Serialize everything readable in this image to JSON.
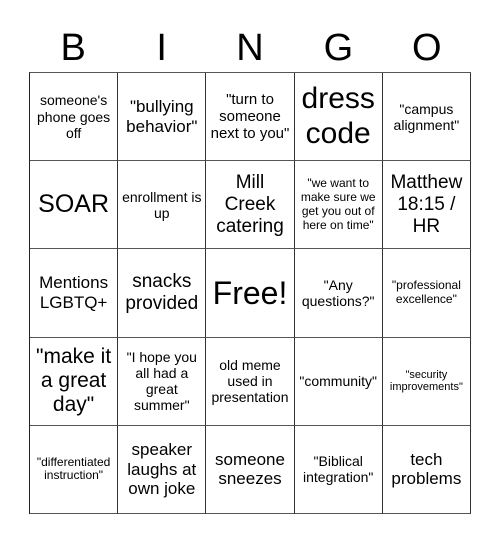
{
  "card": {
    "header": [
      "B",
      "I",
      "N",
      "G",
      "O"
    ],
    "rows": [
      [
        {
          "text": "someone's phone goes off",
          "size": "fs-m"
        },
        {
          "text": "\"bullying behavior\"",
          "size": "fs-l"
        },
        {
          "text": "\"turn to someone next to you\"",
          "size": "fs-ml"
        },
        {
          "text": "dress code",
          "size": "fs-huge"
        },
        {
          "text": "\"campus alignment\"",
          "size": "fs-m"
        }
      ],
      [
        {
          "text": "SOAR",
          "size": "fs-big"
        },
        {
          "text": "enrollment is up",
          "size": "fs-m"
        },
        {
          "text": "Mill Creek catering",
          "size": "fs-xl"
        },
        {
          "text": "\"we want to make sure we get you out of here on time\"",
          "size": "fs-s"
        },
        {
          "text": "Matthew 18:15 / HR",
          "size": "fs-xl"
        }
      ],
      [
        {
          "text": "Mentions LGBTQ+",
          "size": "fs-l"
        },
        {
          "text": "snacks provided",
          "size": "fs-xl"
        },
        {
          "text": "Free!",
          "size": "fs-free"
        },
        {
          "text": "\"Any questions?\"",
          "size": "fs-m"
        },
        {
          "text": "\"professional excellence\"",
          "size": "fs-s"
        }
      ],
      [
        {
          "text": "\"make it a great day\"",
          "size": "fs-xxl"
        },
        {
          "text": "\"I hope you all had a great summer\"",
          "size": "fs-m"
        },
        {
          "text": "old meme used in presentation",
          "size": "fs-m"
        },
        {
          "text": "\"community\"",
          "size": "fs-m"
        },
        {
          "text": "\"security improvements\"",
          "size": "fs-xs"
        }
      ],
      [
        {
          "text": "\"differentiated instruction\"",
          "size": "fs-s"
        },
        {
          "text": "speaker laughs at own joke",
          "size": "fs-l"
        },
        {
          "text": "someone sneezes",
          "size": "fs-l"
        },
        {
          "text": "\"Biblical integration\"",
          "size": "fs-m"
        },
        {
          "text": "tech problems",
          "size": "fs-l"
        }
      ]
    ]
  }
}
